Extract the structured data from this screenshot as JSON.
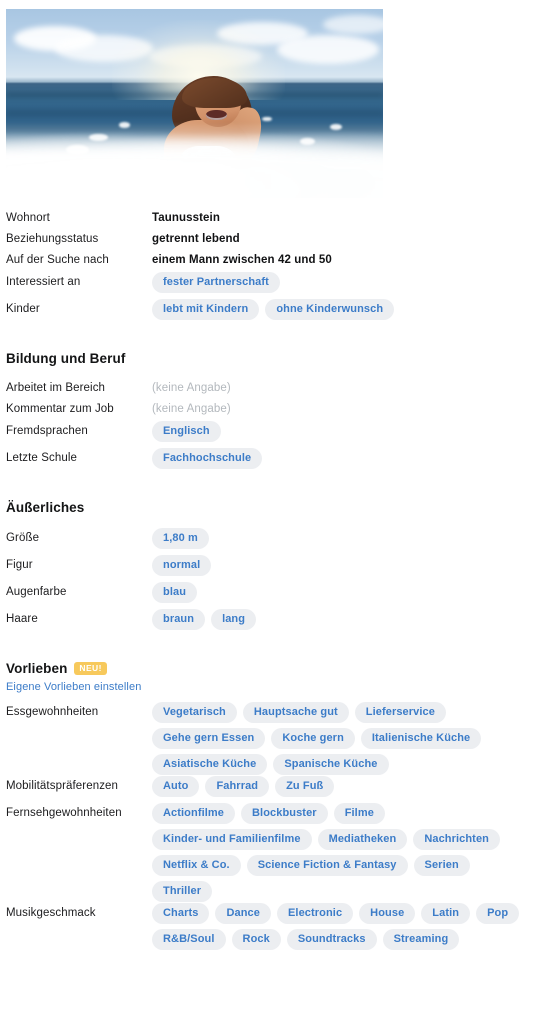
{
  "hero": {
    "alt": "Frau lacht in der Brandung am Meer",
    "name": "profile-photo"
  },
  "basics": {
    "rows": [
      {
        "label": "Wohnort",
        "value": "Taunusstein",
        "type": "text"
      },
      {
        "label": "Beziehungsstatus",
        "value": "getrennt lebend",
        "type": "text"
      },
      {
        "label": "Auf der Suche nach",
        "value": "einem Mann zwischen 42 und 50",
        "type": "text"
      },
      {
        "label": "Interessiert an",
        "tags": [
          "fester Partnerschaft"
        ],
        "type": "pills"
      },
      {
        "label": "Kinder",
        "tags": [
          "lebt mit Kindern",
          "ohne Kinderwunsch"
        ],
        "type": "pills"
      }
    ]
  },
  "education": {
    "title": "Bildung und Beruf",
    "rows": [
      {
        "label": "Arbeitet im Bereich",
        "value": "(keine Angabe)",
        "type": "empty"
      },
      {
        "label": "Kommentar zum Job",
        "value": "(keine Angabe)",
        "type": "empty"
      },
      {
        "label": "Fremdsprachen",
        "tags": [
          "Englisch"
        ],
        "type": "pills"
      },
      {
        "label": "Letzte Schule",
        "tags": [
          "Fachhochschule"
        ],
        "type": "pills"
      }
    ]
  },
  "appearance": {
    "title": "Äußerliches",
    "rows": [
      {
        "label": "Größe",
        "tags": [
          "1,80 m"
        ],
        "type": "pills"
      },
      {
        "label": "Figur",
        "tags": [
          "normal"
        ],
        "type": "pills"
      },
      {
        "label": "Augenfarbe",
        "tags": [
          "blau"
        ],
        "type": "pills"
      },
      {
        "label": "Haare",
        "tags": [
          "braun",
          "lang"
        ],
        "type": "pills"
      }
    ]
  },
  "preferences": {
    "title": "Vorlieben",
    "badge": "NEU!",
    "link": "Eigene Vorlieben einstellen",
    "rows": [
      {
        "label": "Essgewohnheiten",
        "type": "pills",
        "tags": [
          "Vegetarisch",
          "Hauptsache gut",
          "Lieferservice",
          "Gehe gern Essen",
          "Koche gern",
          "Italienische Küche",
          "Asiatische Küche",
          "Spanische Küche"
        ]
      },
      {
        "label": "Mobilitätspräferenzen",
        "type": "pills",
        "tags": [
          "Auto",
          "Fahrrad",
          "Zu Fuß"
        ]
      },
      {
        "label": "Fernsehgewohnheiten",
        "type": "pills",
        "tags": [
          "Actionfilme",
          "Blockbuster",
          "Filme",
          "Kinder- und Familienfilme",
          "Mediatheken",
          "Nachrichten",
          "Netflix & Co.",
          "Science Fiction & Fantasy",
          "Serien",
          "Thriller"
        ]
      },
      {
        "label": "Musikgeschmack",
        "type": "pills",
        "tags": [
          "Charts",
          "Dance",
          "Electronic",
          "House",
          "Latin",
          "Pop",
          "R&B/Soul",
          "Rock",
          "Soundtracks",
          "Streaming"
        ]
      }
    ]
  },
  "colors": {
    "pill_bg": "#eceef1",
    "pill_text": "#3c7cc8",
    "link": "#3c7cc8",
    "badge_bg": "#f7c95c",
    "empty_text": "#b3b8bd",
    "heading": "#141516"
  }
}
